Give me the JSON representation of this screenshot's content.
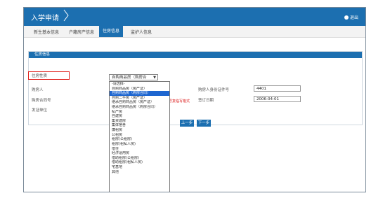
{
  "header": {
    "title": "入学申请",
    "logout_label": "退出"
  },
  "tabs": [
    {
      "label": "新生基本信息"
    },
    {
      "label": "户籍房产信息"
    },
    {
      "label": "住房信息"
    },
    {
      "label": "监护人信息"
    }
  ],
  "panel": {
    "title": "住房信息"
  },
  "form": {
    "housing_type_label": "住房性质",
    "housing_type_value": "自购商品房（购房合",
    "buyer_label": "购房人",
    "contract_no_label": "购房合同号",
    "issuer_label": "发证单位",
    "buyer_id_label": "购房人身份证件号",
    "buyer_id_value": "4401",
    "sign_date_label": "签订日期",
    "sign_date_value": "2006-04-01",
    "warning_text": "号复临写格式"
  },
  "dropdown": {
    "options": [
      "-请选择-",
      "自购商品房（房产证）",
      "自购商品房（购房合同）",
      "自购二手房（房产证）",
      "继承自购商品房（房产证）",
      "继承自购商品房（购房合同）",
      "私产房",
      "自建房",
      "集资建房",
      "集体宿舍",
      "廉租房",
      "公租房",
      "租房(公租房)",
      "租房(租私人房)",
      "借住",
      "经济适用房",
      "借助租房(公租房)",
      "借助租房(租私人房)",
      "宅基地",
      "其他"
    ],
    "selected_index": 2
  },
  "buttons": {
    "prev_label": "上一步",
    "next_label": "下一步"
  }
}
